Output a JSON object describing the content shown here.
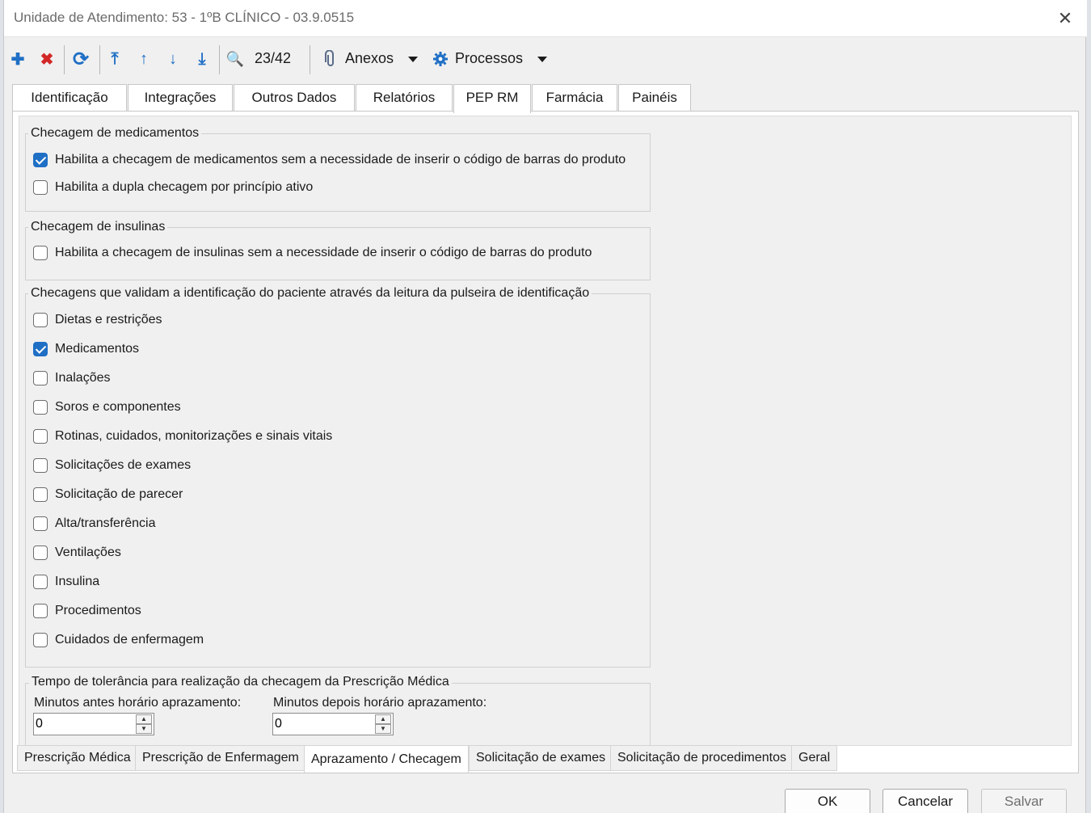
{
  "window": {
    "title": "Unidade de Atendimento: 53 - 1ºB CLÍNICO - 03.9.0515",
    "close_glyph": "✕"
  },
  "toolbar": {
    "add_glyph": "✚",
    "delete_glyph": "✖",
    "refresh_glyph": "⟳",
    "first_glyph": "⤒",
    "prev_glyph": "↑",
    "next_glyph": "↓",
    "last_glyph": "⤓",
    "search_glyph": "🔍",
    "record_counter": "23/42",
    "attachments_label": "Anexos",
    "processes_label": "Processos",
    "icons": [
      "add-icon",
      "delete-icon",
      "refresh-icon",
      "first-record-icon",
      "previous-record-icon",
      "next-record-icon",
      "last-record-icon",
      "search-icon",
      "paperclip-icon",
      "gear-icon"
    ]
  },
  "tabs": [
    {
      "label": "Identificação"
    },
    {
      "label": "Integrações"
    },
    {
      "label": "Outros Dados"
    },
    {
      "label": "Relatórios"
    },
    {
      "label": "PEP RM"
    },
    {
      "label": "Farmácia"
    },
    {
      "label": "Painéis"
    }
  ],
  "groups": {
    "medicamentos": {
      "title": "Checagem de medicamentos",
      "items": [
        {
          "label": "Habilita a checagem de medicamentos sem a necessidade de inserir o código de barras do produto",
          "checked": true
        },
        {
          "label": "Habilita a dupla checagem por princípio ativo",
          "checked": false
        }
      ]
    },
    "insulinas": {
      "title": "Checagem de insulinas",
      "items": [
        {
          "label": "Habilita a checagem de insulinas sem a necessidade de inserir o código de barras do produto",
          "checked": false
        }
      ]
    },
    "pulseira": {
      "title": "Checagens que validam a identificação do paciente através da leitura da pulseira de identificação",
      "items": [
        {
          "label": "Dietas e restrições",
          "checked": false
        },
        {
          "label": "Medicamentos",
          "checked": true
        },
        {
          "label": "Inalações",
          "checked": false
        },
        {
          "label": "Soros e componentes",
          "checked": false
        },
        {
          "label": "Rotinas, cuidados, monitorizações e sinais vitais",
          "checked": false
        },
        {
          "label": "Solicitações de exames",
          "checked": false
        },
        {
          "label": "Solicitação de parecer",
          "checked": false
        },
        {
          "label": "Alta/transferência",
          "checked": false
        },
        {
          "label": "Ventilações",
          "checked": false
        },
        {
          "label": "Insulina",
          "checked": false
        },
        {
          "label": "Procedimentos",
          "checked": false
        },
        {
          "label": "Cuidados de enfermagem",
          "checked": false
        }
      ]
    },
    "tolerancia": {
      "title": "Tempo de tolerância para realização da checagem da Prescrição Médica",
      "before_label": "Minutos antes horário aprazamento:",
      "before_value": "0",
      "after_label": "Minutos depois horário aprazamento:",
      "after_value": "0"
    }
  },
  "subtabs": [
    {
      "label": "Prescrição Médica"
    },
    {
      "label": "Prescrição de Enfermagem"
    },
    {
      "label": "Aprazamento / Checagem"
    },
    {
      "label": "Solicitação de exames"
    },
    {
      "label": "Solicitação de procedimentos"
    },
    {
      "label": "Geral"
    }
  ],
  "buttons": {
    "ok": "OK",
    "cancel": "Cancelar",
    "save": "Salvar"
  },
  "colors": {
    "accent": "#1f6fc5",
    "delete": "#d32727",
    "checkbox_checked": "#1f6fc5"
  }
}
